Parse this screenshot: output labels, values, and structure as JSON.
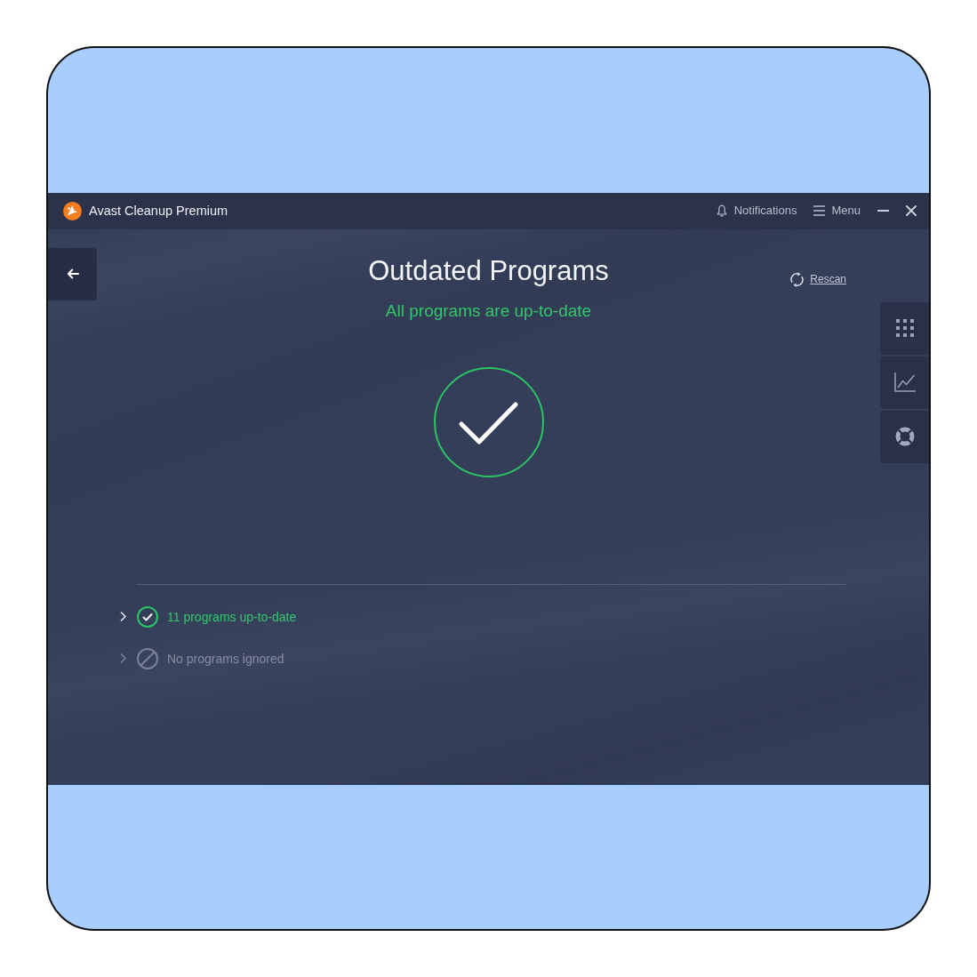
{
  "window": {
    "title": "Avast Cleanup Premium"
  },
  "notifications": {
    "label": "Notifications"
  },
  "menu": {
    "label": "Menu"
  },
  "page": {
    "title": "Outdated Programs",
    "subtitle": "All programs are up-to-date",
    "rescan": "Rescan"
  },
  "results": [
    {
      "kind": "up_to_date",
      "label": "11 programs up-to-date",
      "expanded": false
    },
    {
      "kind": "ignored",
      "label": "No programs ignored",
      "expanded": false
    }
  ]
}
